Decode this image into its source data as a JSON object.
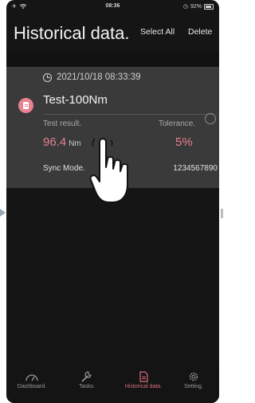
{
  "status_bar": {
    "time": "08:36",
    "battery": "92%"
  },
  "header": {
    "title": "Historical data.",
    "select_all": "Select All",
    "delete": "Delete"
  },
  "record": {
    "datetime": "2021/10/18 08:33:39",
    "name": "Test-100Nm",
    "result_label": "Test result.",
    "result_value": "96.4",
    "result_unit": "Nm",
    "tolerance_label": "Tolerance.",
    "tolerance_value": "5%",
    "sync_label": "Sync Mode.",
    "serial": "1234567890"
  },
  "tabs": [
    {
      "label": "Dashboard.",
      "icon": "gauge-icon"
    },
    {
      "label": "Tasks.",
      "icon": "wrench-icon"
    },
    {
      "label": "Historical data.",
      "icon": "document-icon",
      "active": true
    },
    {
      "label": "Setting.",
      "icon": "gear-icon"
    }
  ],
  "colors": {
    "accent": "#e67f8f",
    "background": "#151515",
    "card": "#3a3a3a"
  }
}
